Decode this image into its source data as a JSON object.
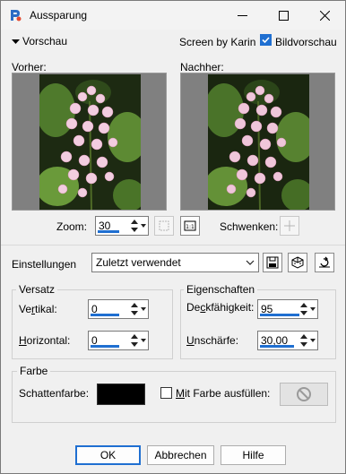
{
  "window": {
    "title": "Aussparung"
  },
  "preview_section": {
    "toggle_label": "Vorschau",
    "credit": "Screen by Karin",
    "bildvorschau_label": "Bildvorschau",
    "bildvorschau_checked": true,
    "before_label": "Vorher:",
    "after_label": "Nachher:"
  },
  "zoom": {
    "label": "Zoom:",
    "value": "30",
    "pan_label": "Schwenken:"
  },
  "settings": {
    "label": "Einstellungen",
    "preset_value": "Zuletzt verwendet"
  },
  "versatz": {
    "title": "Versatz",
    "vertical_label_pre": "Ve",
    "vertical_label_u": "r",
    "vertical_label_post": "tikal:",
    "vertical_value": "0",
    "horizontal_label_u": "H",
    "horizontal_label_post": "orizontal:",
    "horizontal_value": "0"
  },
  "eigenschaften": {
    "title": "Eigenschaften",
    "opacity_label_pre": "De",
    "opacity_label_u": "c",
    "opacity_label_post": "kfähigkeit:",
    "opacity_value": "95",
    "blur_label_u": "U",
    "blur_label_post": "nschärfe:",
    "blur_value": "30,00"
  },
  "farbe": {
    "title": "Farbe",
    "shadow_color_label": "Schattenfarbe:",
    "shadow_color": "#000000",
    "fill_label_u": "M",
    "fill_label_post": "it Farbe ausfüllen:",
    "fill_checked": false
  },
  "buttons": {
    "ok": "OK",
    "cancel": "Abbrechen",
    "help": "Hilfe"
  },
  "colors": {
    "accent": "#1f6fd1"
  }
}
